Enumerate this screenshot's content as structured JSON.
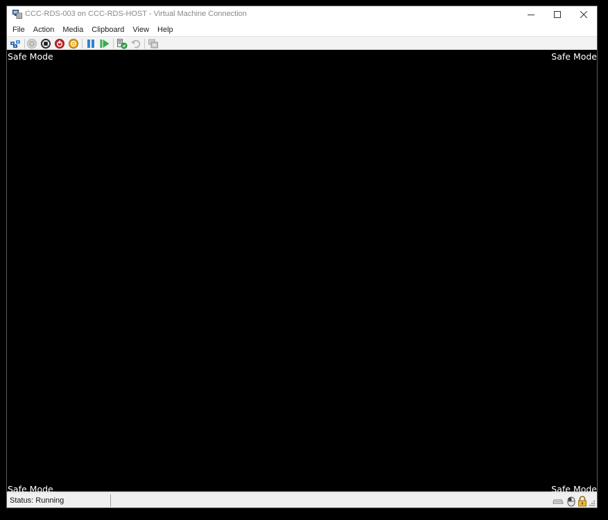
{
  "window": {
    "title": "CCC-RDS-003 on CCC-RDS-HOST - Virtual Machine Connection"
  },
  "menu": {
    "items": [
      {
        "label": "File"
      },
      {
        "label": "Action"
      },
      {
        "label": "Media"
      },
      {
        "label": "Clipboard"
      },
      {
        "label": "View"
      },
      {
        "label": "Help"
      }
    ]
  },
  "toolbar": {
    "icons": [
      "ctrl-alt-del-icon",
      "start-icon",
      "turn-off-icon",
      "shut-down-icon",
      "save-icon",
      "pause-icon",
      "resume-icon",
      "checkpoint-icon",
      "revert-icon",
      "enhanced-session-icon"
    ]
  },
  "screen": {
    "overlay_text": "Safe Mode",
    "background": "#000000"
  },
  "status": {
    "text": "Status: Running"
  },
  "colors": {
    "accent_red": "#c0282d",
    "accent_orange": "#e8a21b",
    "accent_blue": "#2f83d1",
    "accent_green": "#2fb04a"
  }
}
